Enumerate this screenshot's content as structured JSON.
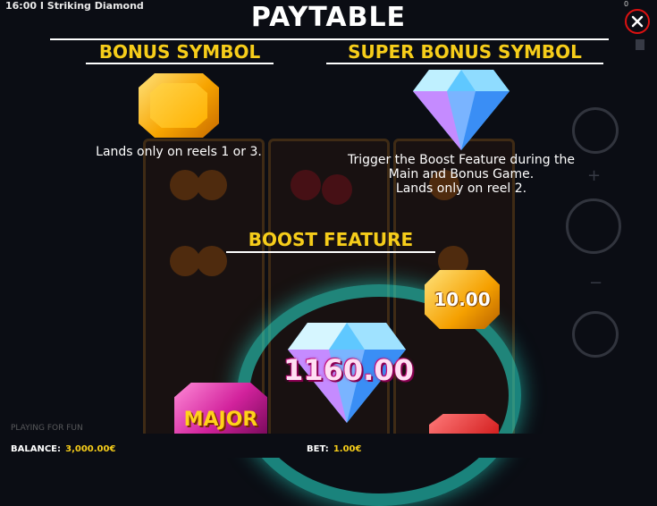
{
  "window": {
    "title": "16:00 I Striking Diamond",
    "corner_value": "0"
  },
  "paytable": {
    "title": "PAYTABLE",
    "bonus_symbol": {
      "heading": "BONUS SYMBOL",
      "description": "Lands only on reels 1 or 3."
    },
    "super_bonus_symbol": {
      "heading": "SUPER BONUS SYMBOL",
      "description_lines": [
        "Trigger the Boost Feature during the",
        "Main and Bonus Game.",
        "Lands only on reel 2."
      ]
    },
    "boost_feature": {
      "heading": "BOOST FEATURE",
      "win_amount": "1160.00",
      "gold_value": "10.00",
      "jackpot_label": "MAJOR"
    }
  },
  "footer": {
    "fun_label": "PLAYING FOR FUN",
    "balance_label": "BALANCE:",
    "balance_value": "3,000.00€",
    "bet_label": "BET:",
    "bet_value": "1.00€"
  },
  "colors": {
    "accent_gold": "#f6cd1a",
    "close_red": "#d11111",
    "boost_glow": "#28e6d2"
  },
  "icons": [
    "close-icon",
    "bonus-orange-gem-icon",
    "super-bonus-diamond-icon",
    "lightning-icon",
    "plus-icon",
    "minus-icon",
    "spin-icon",
    "sound-icon"
  ]
}
